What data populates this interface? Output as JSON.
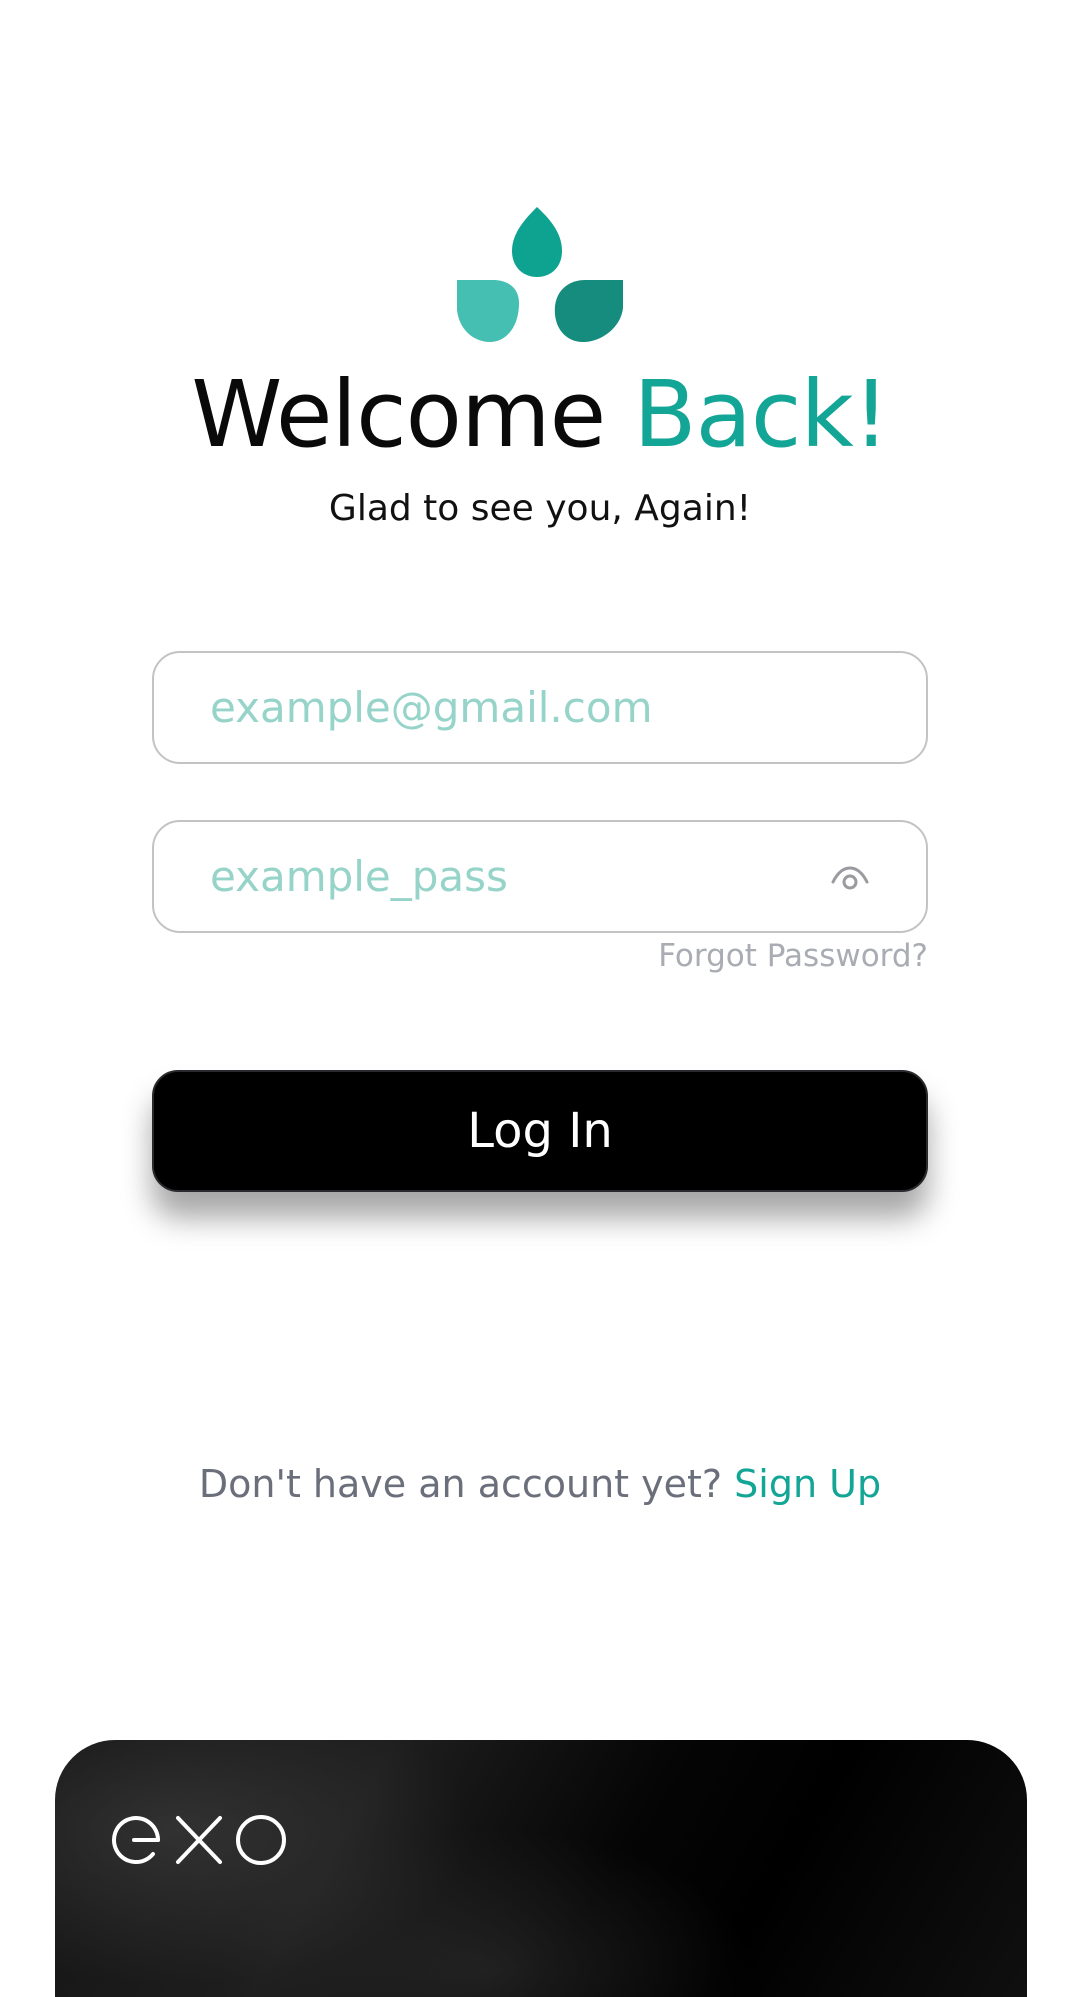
{
  "header": {
    "title_main": "Welcome ",
    "title_accent": "Back!",
    "subtitle": "Glad to see you, Again!"
  },
  "form": {
    "email_placeholder": "example@gmail.com",
    "password_placeholder": "example_pass",
    "forgot_label": "Forgot Password?",
    "login_label": "Log In"
  },
  "footer": {
    "prompt": "Don't have an account yet? ",
    "signup_label": "Sign Up"
  },
  "card": {
    "brand": "exo"
  },
  "icons": {
    "app_logo": "leaves-icon",
    "password_toggle": "eye-icon"
  },
  "colors": {
    "accent": "#13a595",
    "placeholder": "#96d3c9",
    "muted": "#6b6f7b",
    "button": "#000000"
  }
}
